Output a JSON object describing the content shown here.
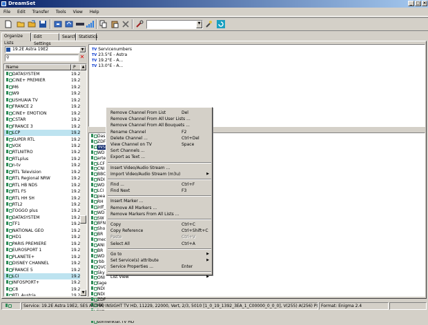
{
  "window": {
    "title": "DreamSet"
  },
  "menu": [
    "File",
    "Edit",
    "Transfer",
    "Tools",
    "View",
    "Help"
  ],
  "tabs": [
    "Organize Lists",
    "Edit Settings",
    "Search",
    "Statistics"
  ],
  "left": {
    "satellite": "19.2E Astra 19E2",
    "search_value": "",
    "columns": {
      "name": "Name",
      "pos": "P"
    },
    "rows": [
      {
        "name": "DATASYSTEM",
        "pos": "19.2",
        "sel": false
      },
      {
        "name": "CINE+ PREMIER",
        "pos": "19.2",
        "sel": false
      },
      {
        "name": "M6",
        "pos": "19.2",
        "sel": false
      },
      {
        "name": "W9",
        "pos": "19.2",
        "sel": false
      },
      {
        "name": "USHUAIA TV",
        "pos": "19.2",
        "sel": false
      },
      {
        "name": "FRANCE 2",
        "pos": "19.2",
        "sel": false
      },
      {
        "name": "CINE+ EMOTION",
        "pos": "19.2",
        "sel": false
      },
      {
        "name": "CSTAR",
        "pos": "19.2",
        "sel": false
      },
      {
        "name": "FRANCE 3",
        "pos": "19.2",
        "sel": false
      },
      {
        "name": "LCP",
        "pos": "19.2",
        "sel": true
      },
      {
        "name": "SUPER RTL",
        "pos": "19.2",
        "sel": false
      },
      {
        "name": "VOX",
        "pos": "19.2",
        "sel": false
      },
      {
        "name": "RTLNITRO",
        "pos": "19.2",
        "sel": false
      },
      {
        "name": "RTLplus",
        "pos": "19.2",
        "sel": false
      },
      {
        "name": "n-tv",
        "pos": "19.2",
        "sel": false
      },
      {
        "name": "RTL Television",
        "pos": "19.2",
        "sel": false
      },
      {
        "name": "RTL Regional NRW",
        "pos": "19.2",
        "sel": false
      },
      {
        "name": "RTL HB NDS",
        "pos": "19.2",
        "sel": false
      },
      {
        "name": "RTL FS",
        "pos": "19.2",
        "sel": false
      },
      {
        "name": "RTL HH SH",
        "pos": "19.2",
        "sel": false
      },
      {
        "name": "RTL2",
        "pos": "19.2",
        "sel": false
      },
      {
        "name": "TOGGO plus",
        "pos": "19.2",
        "sel": false
      },
      {
        "name": "DATASYSTEM",
        "pos": "19.2",
        "sel": false
      },
      {
        "name": "TF1",
        "pos": "19.2",
        "sel": false
      },
      {
        "name": "NATIONAL GEO",
        "pos": "19.2",
        "sel": false
      },
      {
        "name": "HD1",
        "pos": "19.2",
        "sel": false
      },
      {
        "name": "PARIS PREMIERE",
        "pos": "19.2",
        "sel": false
      },
      {
        "name": "EUROSPORT 1",
        "pos": "19.2",
        "sel": false
      },
      {
        "name": "PLANETE+",
        "pos": "19.2",
        "sel": false
      },
      {
        "name": "DISNEY CHANNEL",
        "pos": "19.2",
        "sel": false
      },
      {
        "name": "FRANCE 5",
        "pos": "19.2",
        "sel": false
      },
      {
        "name": "LCI",
        "pos": "19.2",
        "sel": true
      },
      {
        "name": "INFOSPORT+",
        "pos": "19.2",
        "sel": false
      },
      {
        "name": "C8",
        "pos": "19.2",
        "sel": false
      },
      {
        "name": "RTL Austria",
        "pos": "19.2",
        "sel": false
      }
    ]
  },
  "bouquets": [
    "Servicenumbers",
    "23.5°E - Astra",
    "19.2°E - A...",
    "13.0°E - A..."
  ],
  "channels_col1": [
    "Das Erste HD",
    "ZDF HD",
    "INSIGHT TV HD",
    "WD",
    "arte",
    "LCF",
    "CNI",
    "BBC",
    "NDI",
    "WD",
    "LCI",
    "pea",
    "RH",
    "zdf_",
    "WD",
    "SW",
    "BFN",
    "Sho",
    "BR",
    "mec",
    "ANI",
    "BR",
    "WD",
    "rbb",
    "QVC",
    "Sky",
    "ONI",
    "tage",
    "NDI",
    "NDI",
    "ZDF",
    "rbb",
    "Juw",
    "QVC HD",
    "sonnenklar.TV HD"
  ],
  "channels_col2": [
    "QVC PLUS HD",
    "1-2-3.tv HD",
    "BR Fernsehen Nord HD"
  ],
  "context_menu": [
    {
      "label": "Remove Channel From List",
      "shortcut": "Del"
    },
    {
      "label": "Remove Channel From All User Lists ...",
      "shortcut": ""
    },
    {
      "label": "Remove Channel From All Bouquets ...",
      "shortcut": ""
    },
    {
      "label": "Rename Channel",
      "shortcut": "F2"
    },
    {
      "label": "Delete Channel ...",
      "shortcut": "Ctrl+Del"
    },
    {
      "label": "View Channel on TV",
      "shortcut": "Space"
    },
    {
      "label": "Sort Channels ...",
      "shortcut": ""
    },
    {
      "label": "Export as Text ...",
      "shortcut": ""
    },
    {
      "sep": true
    },
    {
      "label": "Insert Video/Audio Stream ...",
      "shortcut": ""
    },
    {
      "label": "Import Video/Audio Stream (m3u)",
      "shortcut": "",
      "submenu": true
    },
    {
      "sep": true
    },
    {
      "label": "Find ...",
      "shortcut": "Ctrl+F"
    },
    {
      "label": "Find Next",
      "shortcut": "F3"
    },
    {
      "sep": true
    },
    {
      "label": "Insert Marker ...",
      "shortcut": ""
    },
    {
      "label": "Remove All Markers ...",
      "shortcut": ""
    },
    {
      "label": "Remove Markers From All Lists ...",
      "shortcut": ""
    },
    {
      "sep": true
    },
    {
      "label": "Copy",
      "shortcut": "Ctrl+C"
    },
    {
      "label": "Copy Reference",
      "shortcut": "Ctrl+Shift+C"
    },
    {
      "label": "Paste",
      "shortcut": "Ctrl+V",
      "disabled": true
    },
    {
      "label": "Select All",
      "shortcut": "Ctrl+A"
    },
    {
      "sep": true
    },
    {
      "label": "Go to",
      "shortcut": "",
      "submenu": true
    },
    {
      "label": "Set Service(s) attribute",
      "shortcut": "",
      "submenu": true
    },
    {
      "label": "Service Properties ...",
      "shortcut": "Enter"
    },
    {
      "sep": true
    },
    {
      "label": "List View",
      "shortcut": "",
      "submenu": true
    }
  ],
  "status": {
    "service": "Service: 19.2E Astra 19E2, SES ASTRA, INSIGHT TV HD, 11229, 22000, Vert, 2/3, 5010 [1_0_19_1392_3EA_1_C00000_0_0_0], V(255) A(256) P(255), TV All, 19,2°E - As",
    "format": "Format: Enigma 2.4"
  },
  "colors": {
    "titlebar_start": "#0a246a",
    "titlebar_end": "#a6caf0",
    "selection": "#bde3f0",
    "face": "#d4d0c8"
  }
}
